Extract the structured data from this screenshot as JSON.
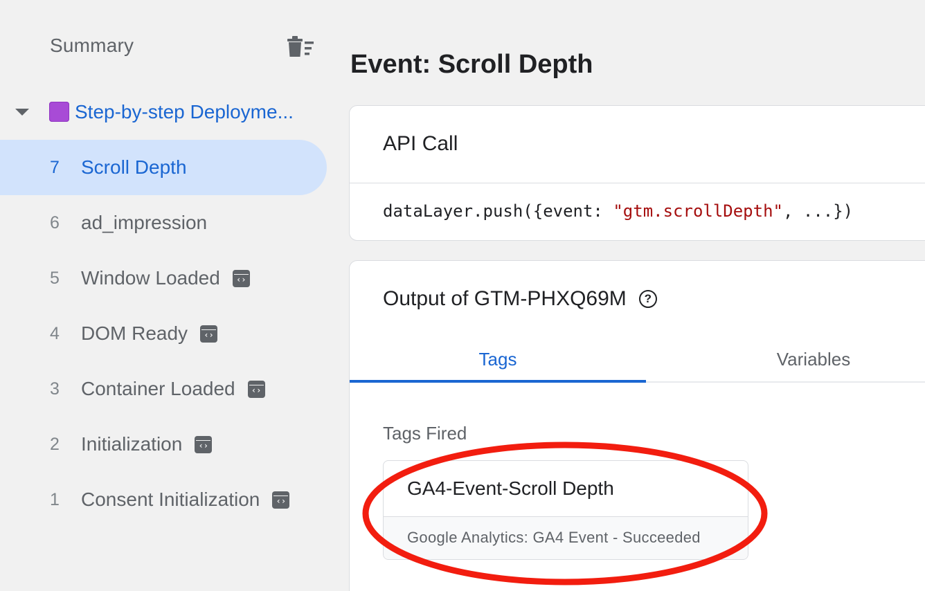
{
  "sidebar": {
    "summary_label": "Summary",
    "container": {
      "name": "Step-by-step Deployme...",
      "color": "#a84bd6",
      "expanded": true
    },
    "events": [
      {
        "number": "7",
        "label": "Scroll Depth",
        "selected": true,
        "badge": false
      },
      {
        "number": "6",
        "label": "ad_impression",
        "selected": false,
        "badge": false
      },
      {
        "number": "5",
        "label": "Window Loaded",
        "selected": false,
        "badge": true
      },
      {
        "number": "4",
        "label": "DOM Ready",
        "selected": false,
        "badge": true
      },
      {
        "number": "3",
        "label": "Container Loaded",
        "selected": false,
        "badge": true
      },
      {
        "number": "2",
        "label": "Initialization",
        "selected": false,
        "badge": true
      },
      {
        "number": "1",
        "label": "Consent Initialization",
        "selected": false,
        "badge": true
      }
    ]
  },
  "main": {
    "title": "Event: Scroll Depth",
    "api_call": {
      "title": "API Call",
      "code_prefix": "dataLayer.push({event: ",
      "code_string": "\"gtm.scrollDepth\"",
      "code_suffix": ", ...})"
    },
    "output": {
      "title": "Output of GTM-PHXQ69M",
      "help_glyph": "?",
      "tabs": [
        {
          "label": "Tags",
          "active": true
        },
        {
          "label": "Variables",
          "active": false
        }
      ],
      "section_label": "Tags Fired",
      "tags_fired": [
        {
          "name": "GA4-Event-Scroll Depth",
          "status": "Google Analytics: GA4 Event - Succeeded"
        }
      ]
    }
  },
  "colors": {
    "accent": "#1a66d2",
    "selected_bg": "#d2e3fc",
    "annotation": "#f21d0f",
    "code_string": "#a50e0e"
  }
}
